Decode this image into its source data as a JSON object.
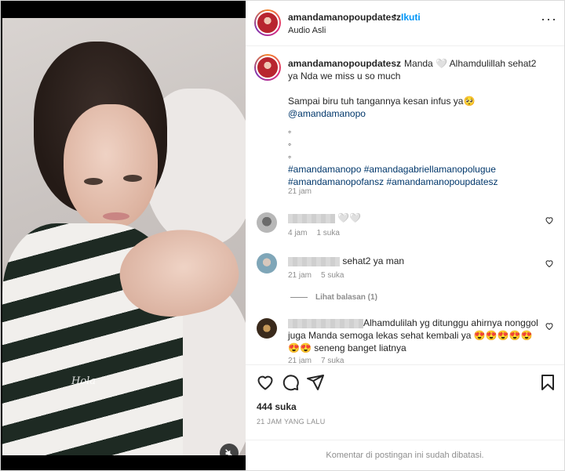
{
  "post": {
    "username": "amandamanopoupdatesz",
    "follow_label": "Ikuti",
    "dot": "•",
    "audio": "Audio Asli",
    "more_icon": "more-options-icon",
    "video": {
      "watermark": "Hola",
      "mute_icon": "speaker-muted-icon"
    }
  },
  "caption": {
    "username": "amandamanopoupdatesz",
    "text1": "Manda 🤍 Alhamdulillah sehat2 ya Nda we miss u so much",
    "text2": "Sampai biru tuh tangannya kesan infus ya🥺",
    "mention": "@amandamanopo",
    "bullets": [
      "◦",
      "◦",
      "◦"
    ],
    "hashtags": [
      "#amandamanopo",
      "#amandagabriellamanopolugue",
      "#amandamanopofansz",
      "#amandamanopoupdatesz"
    ],
    "time": "21 jam"
  },
  "comments": [
    {
      "text": "🤍🤍",
      "time": "4 jam",
      "likes": "1 suka"
    },
    {
      "text": "sehat2 ya man",
      "time": "21 jam",
      "likes": "5 suka"
    },
    {
      "text": "Alhamdulilah yg ditunggu ahirnya nonggol juga Manda semoga lekas sehat kembali ya 😍😍😍😍😍😍😍 seneng banget liatnya",
      "time": "21 jam",
      "likes": "7 suka"
    }
  ],
  "view_replies": "Lihat balasan (1)",
  "actions": {
    "likes": "444 suka",
    "date": "21 JAM YANG LALU",
    "disabled_note": "Komentar di postingan ini sudah dibatasi."
  }
}
